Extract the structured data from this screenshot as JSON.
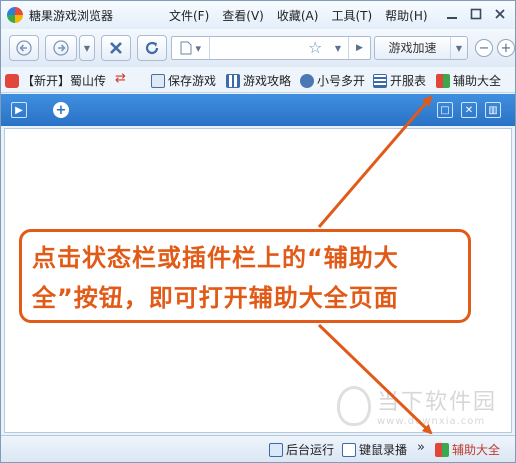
{
  "window": {
    "title": "糖果游戏浏览器",
    "menu": [
      "文件(F)",
      "查看(V)",
      "收藏(A)",
      "工具(T)",
      "帮助(H)"
    ]
  },
  "toolbar": {
    "address_value": "",
    "speed_label": "游戏加速",
    "icons": [
      "back-icon",
      "forward-icon",
      "stop-icon",
      "refresh-icon",
      "page-icon",
      "star-icon",
      "zoom-out-icon",
      "zoom-in-icon"
    ]
  },
  "bookmarks": [
    {
      "label": "【新开】蜀山传",
      "icon": "heart-icon"
    },
    {
      "label": "保存游戏",
      "icon": "save-icon"
    },
    {
      "label": "游戏攻略",
      "icon": "guide-icon"
    },
    {
      "label": "小号多开",
      "icon": "multi-account-icon"
    },
    {
      "label": "开服表",
      "icon": "server-list-icon"
    },
    {
      "label": "辅助大全",
      "icon": "assist-icon"
    }
  ],
  "statusbar": {
    "items": [
      {
        "label": "后台运行",
        "icon": "background-run-icon"
      },
      {
        "label": "键鼠录播",
        "icon": "record-icon"
      }
    ],
    "more": "»",
    "assist_label": "辅助大全"
  },
  "annotation": {
    "line1": "点击状态栏或插件栏上的“辅助大",
    "line2": "全”按钮，即可打开辅助大全页面",
    "color": "#e15a17"
  },
  "watermark": {
    "name": "当下软件园",
    "url": "www.downxia.com"
  }
}
